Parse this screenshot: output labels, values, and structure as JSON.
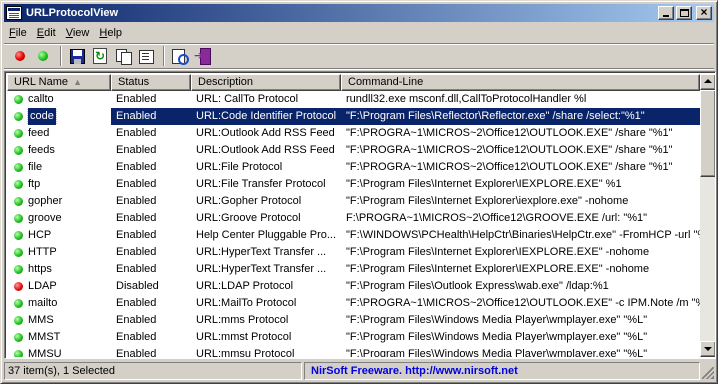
{
  "window": {
    "title": "URLProtocolView"
  },
  "menu": [
    {
      "label": "File",
      "underline": "F",
      "rest": "ile"
    },
    {
      "label": "Edit",
      "underline": "E",
      "rest": "dit"
    },
    {
      "label": "View",
      "underline": "V",
      "rest": "iew"
    },
    {
      "label": "Help",
      "underline": "H",
      "rest": "elp"
    }
  ],
  "toolbar": {
    "buttons": [
      {
        "icon": "disable-red-dot-icon"
      },
      {
        "icon": "enable-green-dot-icon"
      },
      {
        "icon": "save-icon"
      },
      {
        "icon": "refresh-icon"
      },
      {
        "icon": "copy-icon"
      },
      {
        "icon": "properties-icon"
      },
      {
        "icon": "find-icon"
      },
      {
        "icon": "exit-icon"
      }
    ]
  },
  "table": {
    "columns": [
      "URL Name",
      "Status",
      "Description",
      "Command-Line"
    ],
    "sorted_column": "URL Name",
    "selected_row": 1,
    "rows": [
      {
        "name": "callto",
        "status": "Enabled",
        "description": "URL: CallTo Protocol",
        "command": "rundll32.exe msconf.dll,CallToProtocolHandler %l"
      },
      {
        "name": "code",
        "status": "Enabled",
        "description": "URL:Code Identifier Protocol",
        "command": "\"F:\\Program Files\\Reflector\\Reflector.exe\" /share /select:\"%1\""
      },
      {
        "name": "feed",
        "status": "Enabled",
        "description": "URL:Outlook Add RSS Feed",
        "command": "\"F:\\PROGRA~1\\MICROS~2\\Office12\\OUTLOOK.EXE\" /share \"%1\""
      },
      {
        "name": "feeds",
        "status": "Enabled",
        "description": "URL:Outlook Add RSS Feed",
        "command": "\"F:\\PROGRA~1\\MICROS~2\\Office12\\OUTLOOK.EXE\" /share \"%1\""
      },
      {
        "name": "file",
        "status": "Enabled",
        "description": "URL:File Protocol",
        "command": "\"F:\\PROGRA~1\\MICROS~2\\Office12\\OUTLOOK.EXE\" /share \"%1\""
      },
      {
        "name": "ftp",
        "status": "Enabled",
        "description": "URL:File Transfer Protocol",
        "command": "\"F:\\Program Files\\Internet Explorer\\IEXPLORE.EXE\" %1"
      },
      {
        "name": "gopher",
        "status": "Enabled",
        "description": "URL:Gopher Protocol",
        "command": "\"F:\\Program Files\\Internet Explorer\\iexplore.exe\" -nohome"
      },
      {
        "name": "groove",
        "status": "Enabled",
        "description": "URL:Groove Protocol",
        "command": "F:\\PROGRA~1\\MICROS~2\\Office12\\GROOVE.EXE /url: \"%1\""
      },
      {
        "name": "HCP",
        "status": "Enabled",
        "description": "Help Center Pluggable Pro...",
        "command": "\"F:\\WINDOWS\\PCHealth\\HelpCtr\\Binaries\\HelpCtr.exe\" -FromHCP -url \"%"
      },
      {
        "name": "HTTP",
        "status": "Enabled",
        "description": "URL:HyperText Transfer ...",
        "command": "\"F:\\Program Files\\Internet Explorer\\IEXPLORE.EXE\" -nohome"
      },
      {
        "name": "https",
        "status": "Enabled",
        "description": "URL:HyperText Transfer ...",
        "command": "\"F:\\Program Files\\Internet Explorer\\IEXPLORE.EXE\" -nohome"
      },
      {
        "name": "LDAP",
        "status": "Disabled",
        "description": "URL:LDAP Protocol",
        "command": "\"F:\\Program Files\\Outlook Express\\wab.exe\" /ldap:%1"
      },
      {
        "name": "mailto",
        "status": "Enabled",
        "description": "URL:MailTo Protocol",
        "command": "\"F:\\PROGRA~1\\MICROS~2\\Office12\\OUTLOOK.EXE\" -c IPM.Note /m \"%1"
      },
      {
        "name": "MMS",
        "status": "Enabled",
        "description": "URL:mms Protocol",
        "command": "\"F:\\Program Files\\Windows Media Player\\wmplayer.exe\" \"%L\""
      },
      {
        "name": "MMST",
        "status": "Enabled",
        "description": "URL:mmst Protocol",
        "command": "\"F:\\Program Files\\Windows Media Player\\wmplayer.exe\" \"%L\""
      },
      {
        "name": "MMSU",
        "status": "Enabled",
        "description": "URL:mmsu Protocol",
        "command": "\"F:\\Program Files\\Windows Media Player\\wmplayer.exe\" \"%L\""
      }
    ]
  },
  "statusbar": {
    "count_text": "37 item(s), 1 Selected",
    "credit_text": "NirSoft Freeware.  http://www.nirsoft.net"
  },
  "colors": {
    "titlebar_start": "#0a246a",
    "titlebar_end": "#a6caf0",
    "selection": "#0a246a",
    "enabled_dot": "#22c022",
    "disabled_dot": "#e01010",
    "credit_link": "#0000e0"
  }
}
